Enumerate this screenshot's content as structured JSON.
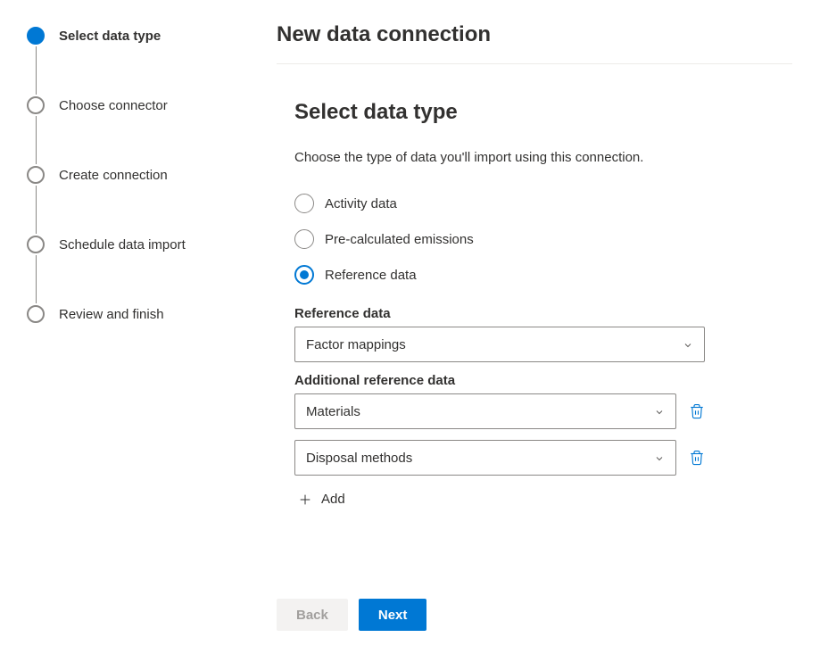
{
  "header": {
    "title": "New data connection"
  },
  "steps": [
    {
      "label": "Select data type",
      "active": true
    },
    {
      "label": "Choose connector",
      "active": false
    },
    {
      "label": "Create connection",
      "active": false
    },
    {
      "label": "Schedule data import",
      "active": false
    },
    {
      "label": "Review and finish",
      "active": false
    }
  ],
  "section": {
    "heading": "Select data type",
    "description": "Choose the type of data you'll import using this connection."
  },
  "dataTypeOptions": [
    {
      "label": "Activity data",
      "selected": false
    },
    {
      "label": "Pre-calculated emissions",
      "selected": false
    },
    {
      "label": "Reference data",
      "selected": true
    }
  ],
  "referenceData": {
    "label": "Reference data",
    "value": "Factor mappings"
  },
  "additional": {
    "label": "Additional reference data",
    "items": [
      {
        "value": "Materials"
      },
      {
        "value": "Disposal methods"
      }
    ],
    "addLabel": "Add"
  },
  "footer": {
    "back": "Back",
    "next": "Next"
  }
}
